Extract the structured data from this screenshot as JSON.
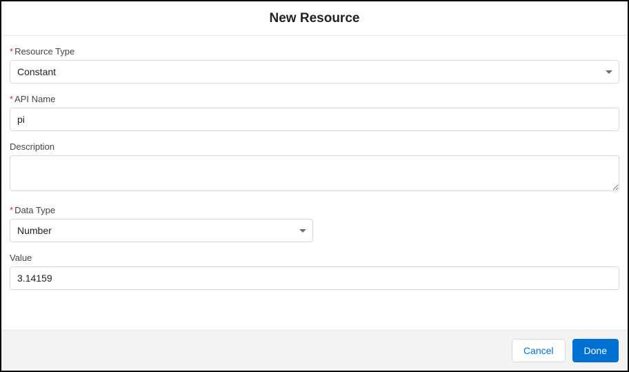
{
  "header": {
    "title": "New Resource"
  },
  "form": {
    "resource_type": {
      "label": "Resource Type",
      "value": "Constant",
      "required": true
    },
    "api_name": {
      "label": "API Name",
      "value": "pi",
      "required": true
    },
    "description": {
      "label": "Description",
      "value": "",
      "required": false
    },
    "data_type": {
      "label": "Data Type",
      "value": "Number",
      "required": true
    },
    "value": {
      "label": "Value",
      "value": "3.14159",
      "required": false
    }
  },
  "footer": {
    "cancel_label": "Cancel",
    "done_label": "Done"
  },
  "required_marker": "*"
}
